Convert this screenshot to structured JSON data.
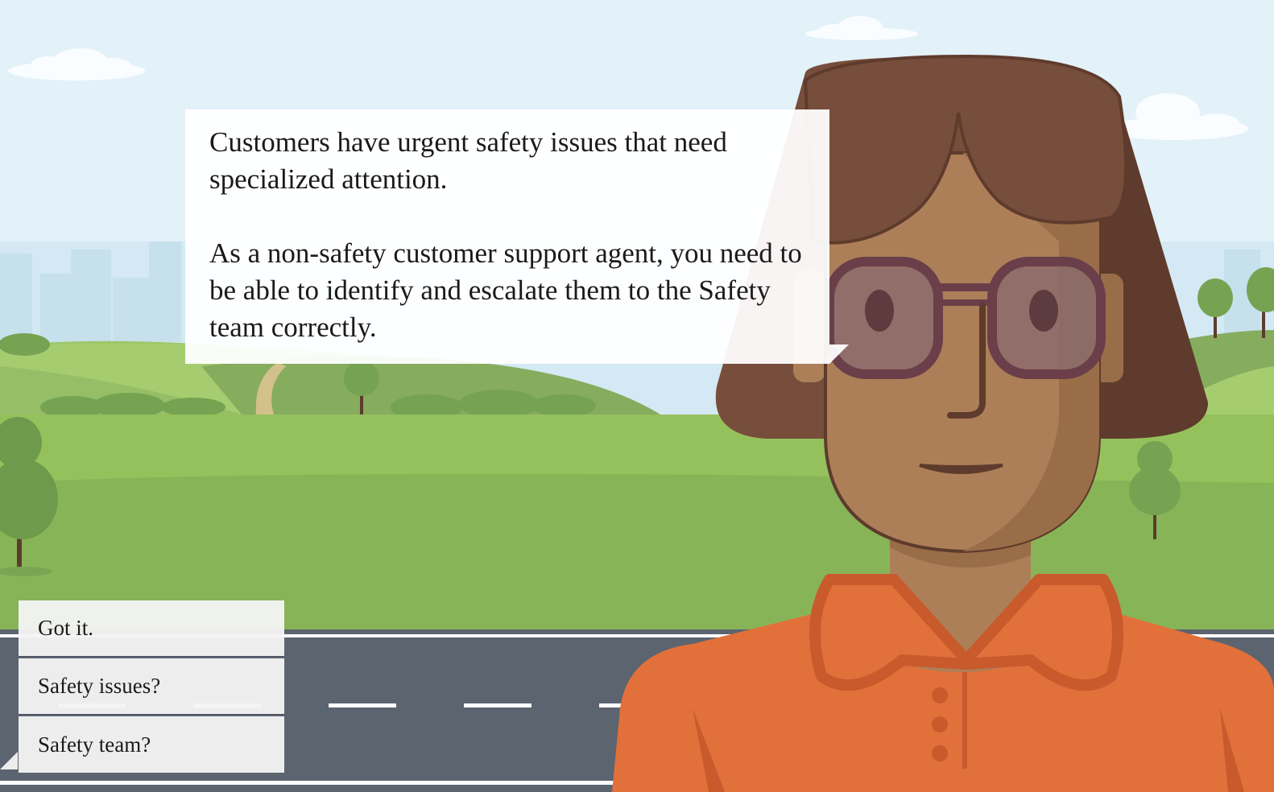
{
  "scene": {
    "character": "woman-with-glasses",
    "colors": {
      "sky": "#e3f1f8",
      "grass": "#8ab85a",
      "road": "#5c6470",
      "hair": "#764e3b",
      "skin": "#ad7f58",
      "shirt": "#e2703a"
    }
  },
  "dialog": {
    "paragraph1": "Customers have urgent safety issues that need specialized attention.",
    "paragraph2": "As a non-safety customer support agent, you need to be able to identify and escalate them to the Safety team correctly."
  },
  "choices": [
    {
      "label": "Got it."
    },
    {
      "label": "Safety issues?"
    },
    {
      "label": "Safety team?"
    }
  ]
}
